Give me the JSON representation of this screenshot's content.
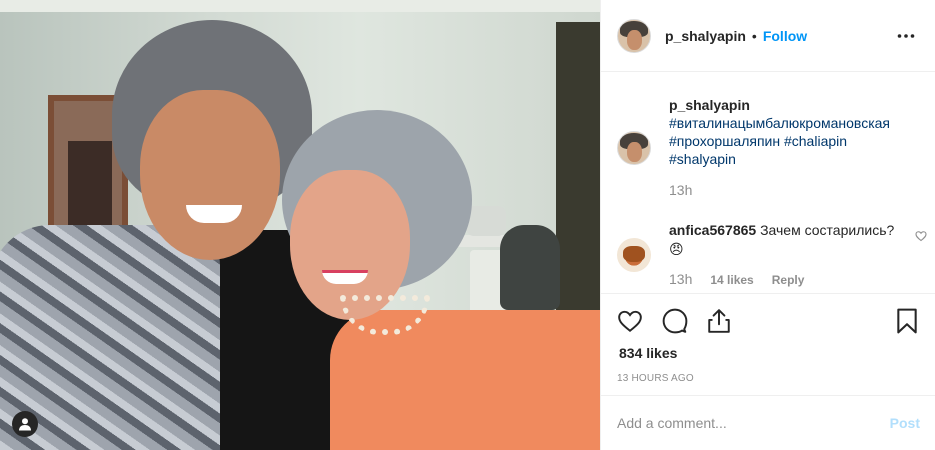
{
  "post": {
    "username": "p_shalyapin",
    "separator": "•",
    "follow_label": "Follow",
    "more_icon": "more-options-icon"
  },
  "caption": {
    "username": "p_shalyapin",
    "hashtags": [
      "#виталинацымбалюкромановская",
      "#прохоршаляпин #chaliapin",
      "#shalyapin"
    ],
    "time": "13h"
  },
  "comment": {
    "username": "anfica567865",
    "text": "Зачем состарились? 😠",
    "time": "13h",
    "likes": "14 likes",
    "reply_label": "Reply",
    "like_icon": "heart-outline-icon"
  },
  "actions": {
    "icons": [
      "heart-outline-icon",
      "comment-icon",
      "share-icon",
      "bookmark-icon"
    ]
  },
  "stats": {
    "likes": "834 likes",
    "posted_ago": "13 HOURS AGO"
  },
  "add_comment": {
    "placeholder": "Add a comment...",
    "post_label": "Post"
  },
  "colors": {
    "link_blue": "#0095f6",
    "hashtag": "#00376b",
    "muted": "#8e8e8e",
    "post_disabled": "#b2dffc"
  }
}
